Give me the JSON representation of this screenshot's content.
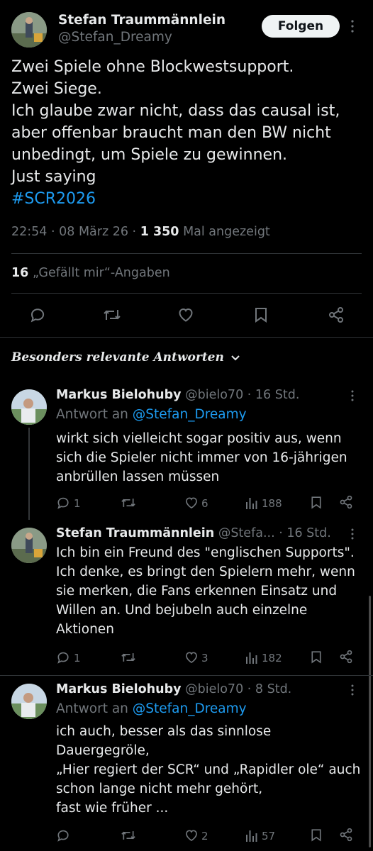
{
  "main_tweet": {
    "author_name": "Stefan Traummännlein",
    "author_handle": "@Stefan_Dreamy",
    "follow_label": "Folgen",
    "text_lines": [
      "Zwei Spiele ohne Blockwestsupport.",
      "Zwei Siege.",
      "Ich glaube zwar nicht, dass das causal ist,",
      "aber offenbar braucht man den BW nicht",
      "unbedingt, um Spiele zu gewinnen.",
      "Just saying"
    ],
    "hashtag": "#SCR2026",
    "time": "22:54 · 08 März 26 · ",
    "views_count": "1 350",
    "views_label": " Mal angezeigt",
    "likes_count": "16",
    "likes_label": "„Gefällt mir“-Angaben"
  },
  "replies_header": "Besonders relevante Antworten",
  "replies": [
    {
      "author_name": "Markus Bielohuby",
      "author_handle": "@bielo70",
      "time": "· 16 Std.",
      "reply_to_prefix": "Antwort an ",
      "reply_to_handle": "@Stefan_Dreamy",
      "text_lines": [
        "wirkt sich vielleicht sogar positiv aus, wenn",
        "sich die Spieler nicht immer von 16-jährigen",
        "anbrüllen lassen müssen"
      ],
      "replies_count": "1",
      "likes_count": "6",
      "views_count": "188"
    },
    {
      "author_name": "Stefan Traummännlein",
      "author_handle": "@Stefa...",
      "time": "· 16 Std.",
      "text_lines": [
        "Ich bin ein Freund des \"englischen Supports\".",
        "Ich denke, es bringt den Spielern mehr, wenn",
        "sie merken, die Fans erkennen Einsatz und",
        "Willen an. Und bejubeln auch einzelne",
        "Aktionen"
      ],
      "replies_count": "1",
      "likes_count": "3",
      "views_count": "182"
    },
    {
      "author_name": "Markus Bielohuby",
      "author_handle": "@bielo70",
      "time": "· 8 Std.",
      "reply_to_prefix": "Antwort an ",
      "reply_to_handle": "@Stefan_Dreamy",
      "text_lines": [
        "ich auch, besser als das sinnlose",
        "Dauergegröle,",
        "„Hier regiert der SCR“ und „Rapidler ole“ auch",
        "schon lange nicht mehr gehört,",
        "fast wie früher ..."
      ],
      "replies_count": "",
      "likes_count": "2",
      "views_count": "57"
    }
  ],
  "colors": {
    "background": "#000000",
    "text": "#e7e9ea",
    "muted": "#71767b",
    "link": "#1d9bf0",
    "divider": "#2f3336"
  }
}
